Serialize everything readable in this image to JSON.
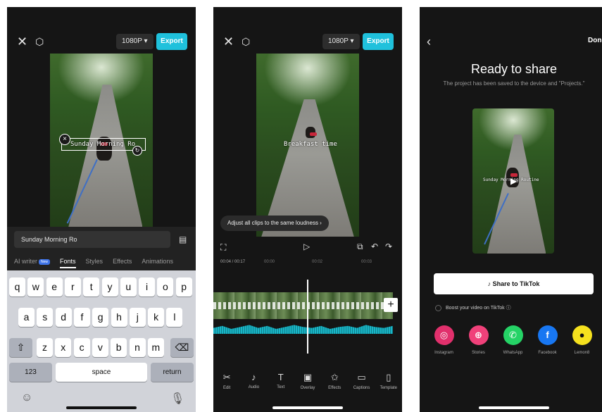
{
  "phone1": {
    "resolution_label": "1080P ▾",
    "export_label": "Export",
    "overlay_text": "Sunday Morning Ro",
    "text_input_value": "Sunday Morning Ro",
    "tabs": [
      {
        "label": "AI writer",
        "badge": "New"
      },
      {
        "label": "Fonts",
        "active": true
      },
      {
        "label": "Styles"
      },
      {
        "label": "Effects"
      },
      {
        "label": "Animations"
      }
    ],
    "keyboard": {
      "row1": [
        "q",
        "w",
        "e",
        "r",
        "t",
        "y",
        "u",
        "i",
        "o",
        "p"
      ],
      "row2": [
        "a",
        "s",
        "d",
        "f",
        "g",
        "h",
        "j",
        "k",
        "l"
      ],
      "row3": [
        "z",
        "x",
        "c",
        "v",
        "b",
        "n",
        "m"
      ],
      "numbers_label": "123",
      "space_label": "space",
      "return_label": "return"
    }
  },
  "phone2": {
    "resolution_label": "1080P ▾",
    "export_label": "Export",
    "overlay_text": "Breakfast time",
    "loudness_hint": "Adjust all clips to the same loudness  ›",
    "time_current": "00:04 / 00:17",
    "ruler": [
      "00:00",
      "00:02",
      "00:03"
    ],
    "tools": [
      {
        "icon": "✂",
        "label": "Edit"
      },
      {
        "icon": "♪",
        "label": "Audio"
      },
      {
        "icon": "T",
        "label": "Text"
      },
      {
        "icon": "▣",
        "label": "Overlay"
      },
      {
        "icon": "✩",
        "label": "Effects"
      },
      {
        "icon": "▭",
        "label": "Captions"
      },
      {
        "icon": "▯",
        "label": "Template"
      }
    ]
  },
  "phone3": {
    "done_label": "Done",
    "title": "Ready to share",
    "subtitle": "The project has been saved to the device and \"Projects.\"",
    "overlay_text": "Sunday Morning Routine",
    "tiktok_label": "Share to TikTok",
    "boost_label": "Boost your video on TikTok ⓘ",
    "share_targets": [
      {
        "label": "Instagram",
        "color": "#e1306c",
        "glyph": "◎"
      },
      {
        "label": "Stories",
        "color": "#f0417a",
        "glyph": "⊕"
      },
      {
        "label": "WhatsApp",
        "color": "#25d366",
        "glyph": "✆"
      },
      {
        "label": "Facebook",
        "color": "#1877f2",
        "glyph": "f"
      },
      {
        "label": "Lemon8",
        "color": "#f5e11e",
        "glyph": "●"
      }
    ]
  }
}
